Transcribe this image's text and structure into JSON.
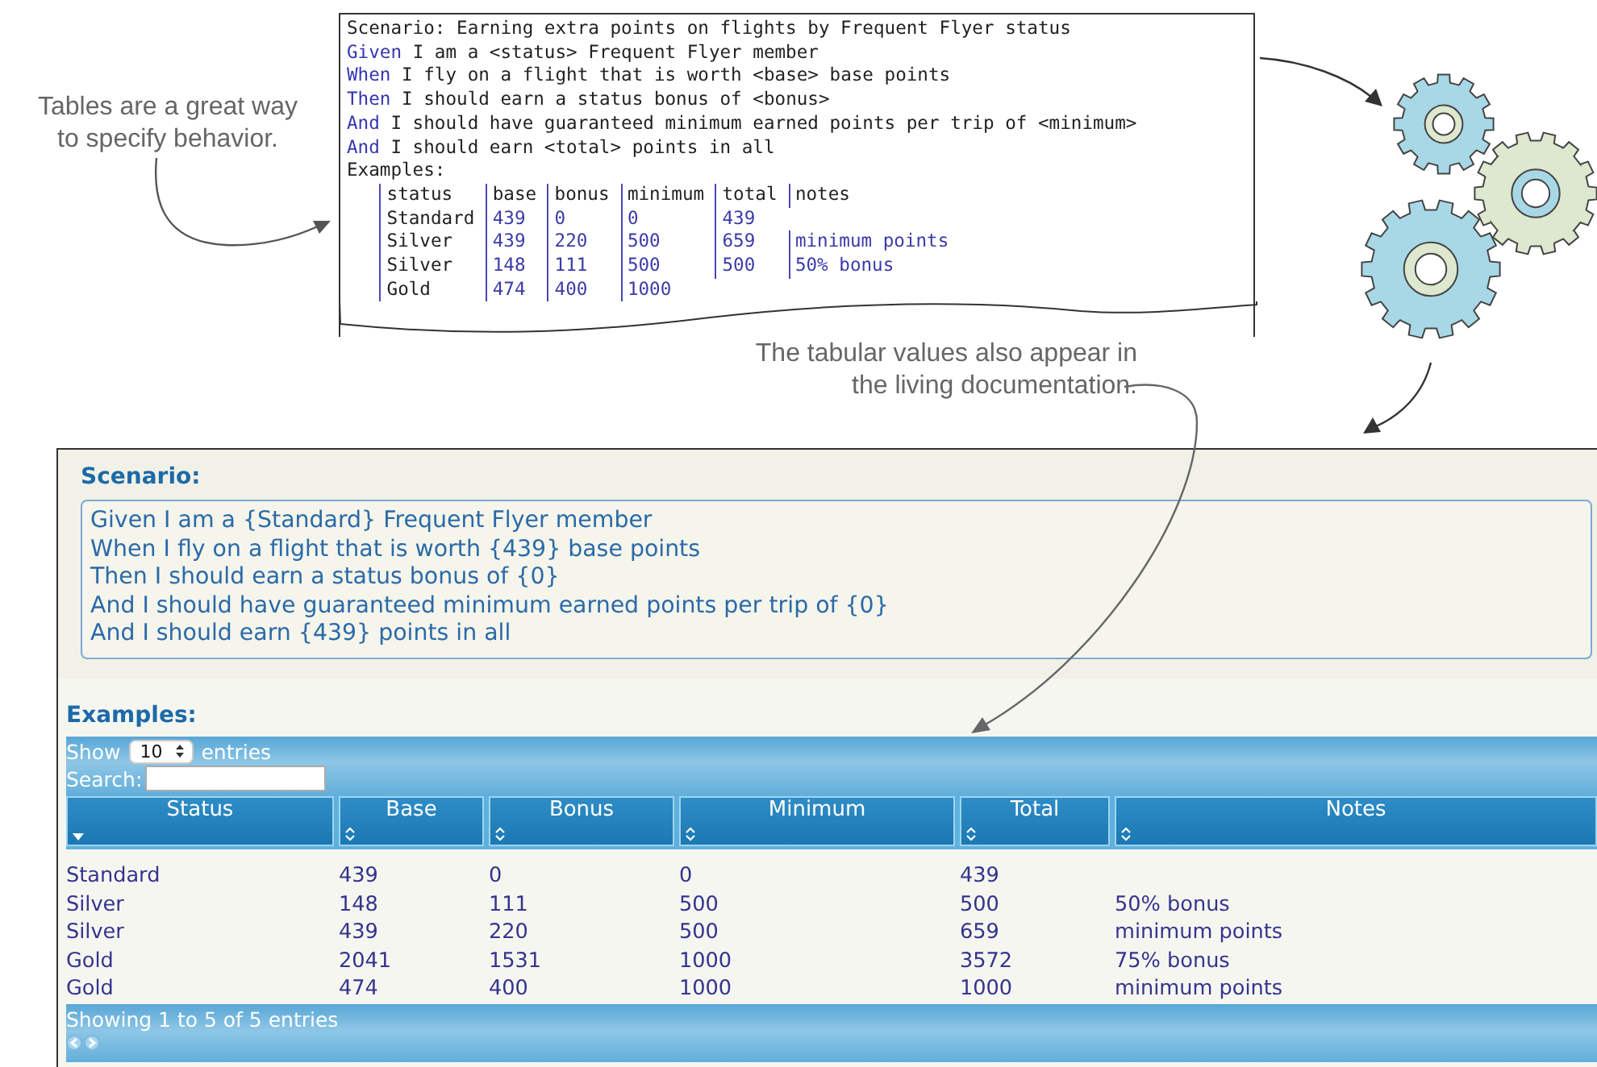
{
  "callouts": [
    {
      "lines": [
        "Tables are a great way",
        "to specify behavior."
      ]
    },
    {
      "lines": [
        "The tabular values also appear in",
        "the living documentation."
      ]
    }
  ],
  "source": {
    "lines": [
      {
        "kind": "title",
        "text": "Scenario: Earning extra points on flights by Frequent Flyer status"
      },
      {
        "kind": "step",
        "keyword": "Given",
        "text": "I am a <status> Frequent Flyer member"
      },
      {
        "kind": "step",
        "keyword": "When",
        "text": "I fly on a flight that is worth <base> base points"
      },
      {
        "kind": "step",
        "keyword": "Then",
        "text": "I should earn a status bonus of <bonus>"
      },
      {
        "kind": "step",
        "keyword": "And",
        "text": "I should have guaranteed minimum earned points per trip of <minimum>"
      },
      {
        "kind": "step",
        "keyword": "And",
        "text": "I should earn <total> points in all"
      },
      {
        "kind": "title",
        "text": "Examples:"
      }
    ],
    "table": [
      [
        "status",
        "base",
        "bonus",
        "minimum",
        "total",
        "notes"
      ],
      [
        "Standard",
        "439",
        "0",
        "0",
        "439"
      ],
      [
        "Silver",
        "439",
        "220",
        "500",
        "659",
        "minimum points"
      ],
      [
        "Silver",
        "148",
        "111",
        "500",
        "500",
        "50% bonus"
      ],
      [
        "Gold",
        "474",
        "400",
        "1000"
      ]
    ]
  },
  "doc": {
    "scenario_heading": "Scenario:",
    "steps": [
      "Given I am a {Standard} Frequent Flyer member",
      "When I fly on a flight that is worth {439} base points",
      "Then I should earn a status bonus of {0}",
      "And I should have guaranteed minimum earned points per trip of {0}",
      "And I should earn {439} points in all"
    ],
    "examples_heading": "Examples:",
    "show_label": "Show",
    "page_size": "10",
    "entries_label": "entries",
    "search_label": "Search:",
    "columns": [
      {
        "label": "Status",
        "sorted": true
      },
      {
        "label": "Base",
        "sorted": false
      },
      {
        "label": "Bonus",
        "sorted": false
      },
      {
        "label": "Minimum",
        "sorted": false
      },
      {
        "label": "Total",
        "sorted": false
      },
      {
        "label": "Notes",
        "sorted": false
      }
    ],
    "rows": [
      [
        "Standard",
        "439",
        "0",
        "0",
        "439",
        ""
      ],
      [
        "Silver",
        "148",
        "111",
        "500",
        "500",
        "50% bonus"
      ],
      [
        "Silver",
        "439",
        "220",
        "500",
        "659",
        "minimum points"
      ],
      [
        "Gold",
        "2041",
        "1531",
        "1000",
        "3572",
        "75% bonus"
      ],
      [
        "Gold",
        "474",
        "400",
        "1000",
        "1000",
        "minimum points"
      ]
    ],
    "info": "Showing 1 to 5 of 5 entries"
  }
}
